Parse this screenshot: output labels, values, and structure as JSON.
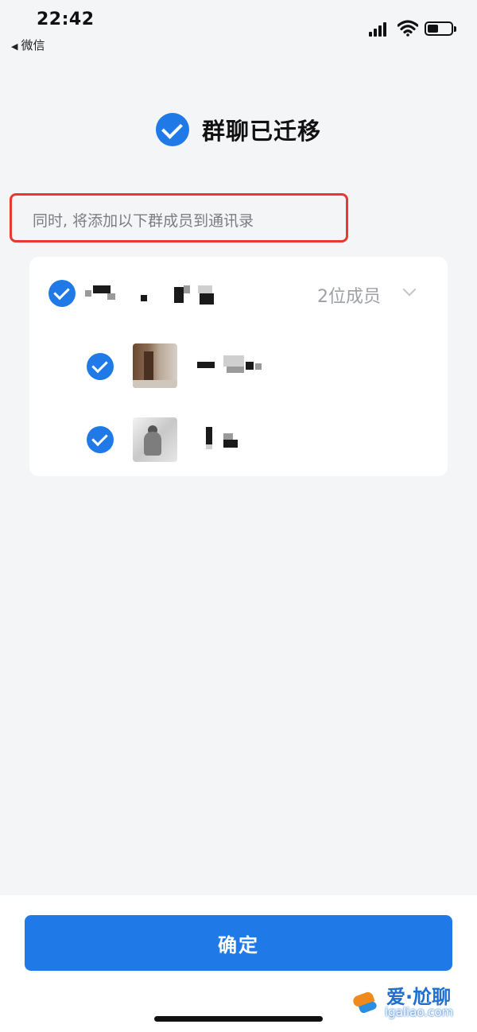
{
  "status_bar": {
    "time": "22:42",
    "back_app": "微信",
    "battery_level": 0.45
  },
  "header": {
    "title": "群聊已迁移"
  },
  "notice": {
    "text": "同时, 将添加以下群成员到通讯录"
  },
  "group": {
    "member_count_label": "2位成员",
    "members": [
      {
        "avatar": "avatar-photo-room"
      },
      {
        "avatar": "avatar-photo-person"
      }
    ]
  },
  "footer": {
    "confirm_label": "确定"
  },
  "watermark": {
    "brand": "爱·尬聊",
    "url": "igaliao.com"
  },
  "colors": {
    "accent": "#1f7ae8",
    "highlight_border": "#e53a2f",
    "page_background": "#f4f5f6"
  }
}
